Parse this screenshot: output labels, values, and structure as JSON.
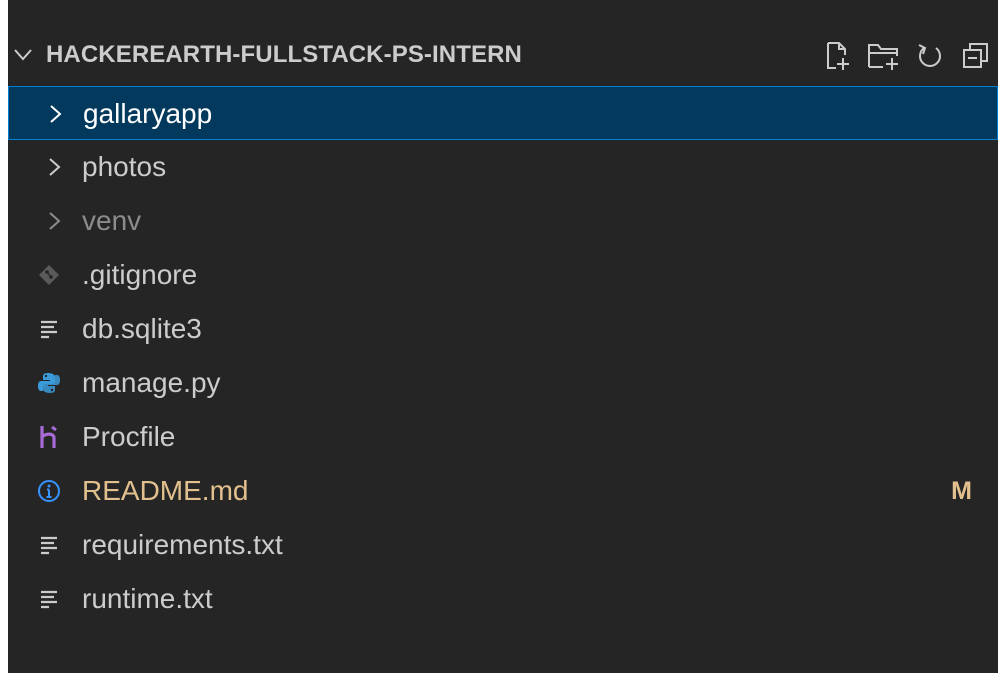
{
  "explorer": {
    "section_title": "HACKEREARTH-FULLSTACK-PS-INTERN",
    "actions": [
      {
        "name": "new-file-icon"
      },
      {
        "name": "new-folder-icon"
      },
      {
        "name": "refresh-icon"
      },
      {
        "name": "collapse-all-icon"
      }
    ],
    "items": [
      {
        "label": "gallaryapp",
        "kind": "folder",
        "selected": true
      },
      {
        "label": "photos",
        "kind": "folder"
      },
      {
        "label": "venv",
        "kind": "folder",
        "dimmed": true
      },
      {
        "label": ".gitignore",
        "kind": "file",
        "icon": "git-icon"
      },
      {
        "label": "db.sqlite3",
        "kind": "file",
        "icon": "lines-file-icon"
      },
      {
        "label": "manage.py",
        "kind": "file",
        "icon": "python-icon"
      },
      {
        "label": "Procfile",
        "kind": "file",
        "icon": "heroku-icon"
      },
      {
        "label": "README.md",
        "kind": "file",
        "icon": "info-icon",
        "status": "M"
      },
      {
        "label": "requirements.txt",
        "kind": "file",
        "icon": "lines-file-icon"
      },
      {
        "label": "runtime.txt",
        "kind": "file",
        "icon": "lines-file-icon"
      }
    ],
    "colors": {
      "background": "#252526",
      "selection": "#04395e",
      "selection_border": "#007fd4",
      "modified": "#e2c08d",
      "python": "#3b9bd9",
      "heroku": "#a66bd6",
      "info": "#3794ff"
    }
  }
}
